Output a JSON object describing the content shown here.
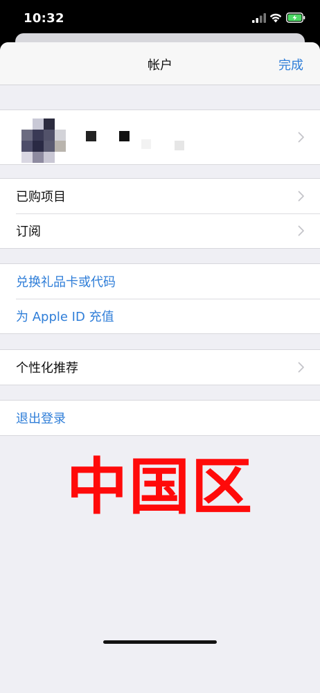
{
  "status_bar": {
    "time": "10:32"
  },
  "nav": {
    "title": "帐户",
    "done_label": "完成"
  },
  "groups": {
    "purchases": [
      {
        "label": "已购项目"
      },
      {
        "label": "订阅"
      }
    ],
    "links": [
      {
        "label": "兑换礼品卡或代码"
      },
      {
        "label": "为 Apple ID 充值"
      }
    ],
    "personalization": [
      {
        "label": "个性化推荐"
      }
    ],
    "signout": [
      {
        "label": "退出登录"
      }
    ]
  },
  "watermark": "中国区",
  "colors": {
    "accent": "#2f7ed8",
    "watermark": "#ff0a0a",
    "background": "#efeff4"
  }
}
